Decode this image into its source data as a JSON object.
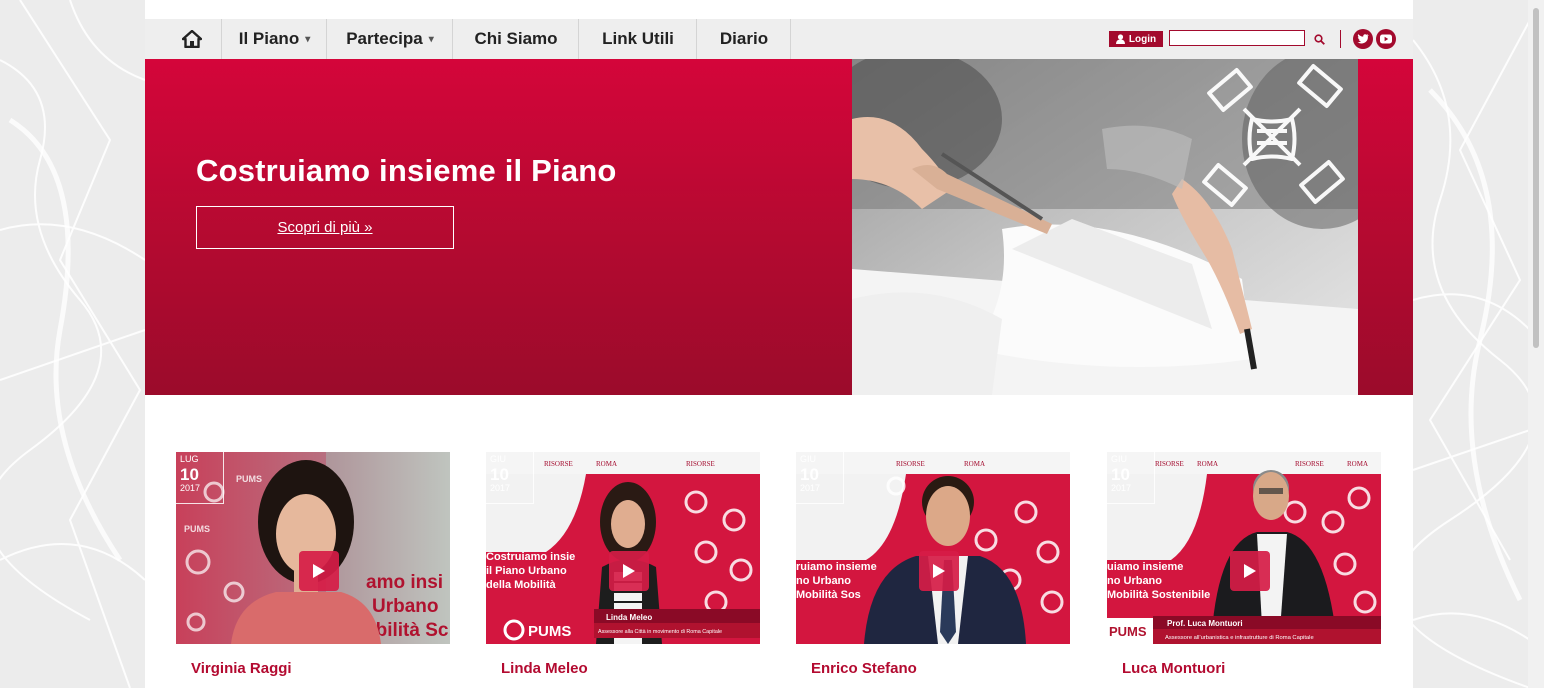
{
  "nav": {
    "items": [
      {
        "label": "Il Piano",
        "caret": "▾"
      },
      {
        "label": "Partecipa",
        "caret": "▾"
      },
      {
        "label": "Chi Siamo",
        "caret": ""
      },
      {
        "label": "Link Utili",
        "caret": ""
      },
      {
        "label": "Diario",
        "caret": ""
      }
    ],
    "login_label": "Login",
    "search": {
      "value": "",
      "placeholder": ""
    },
    "icons": {
      "home": "home-icon",
      "user": "user-icon",
      "search": "search-icon",
      "twitter": "twitter-icon",
      "youtube": "youtube-icon"
    }
  },
  "hero": {
    "title": "Costruiamo insieme il Piano",
    "button_label": "Scopri di più »"
  },
  "videos": [
    {
      "name": "Virginia Raggi",
      "month": "LUG",
      "day": "10",
      "year": "2017",
      "overlay_title": "",
      "overlay_subtitle": "",
      "slide_text": [
        "amo insi",
        "Urbano",
        "obilità Sc"
      ]
    },
    {
      "name": "Linda Meleo",
      "month": "GIU",
      "day": "10",
      "year": "2017",
      "overlay_title": "Linda Meleo",
      "overlay_subtitle": "Assessore alla Città in movimento di Roma Capitale",
      "slide_text": [
        "Costruiamo insie",
        "il Piano Urbano",
        "della Mobilità"
      ]
    },
    {
      "name": "Enrico Stefano",
      "month": "GIU",
      "day": "10",
      "year": "2017",
      "overlay_title": "",
      "overlay_subtitle": "",
      "slide_text": [
        "ruiamo insieme",
        "no Urbano",
        "Mobilità Sos"
      ]
    },
    {
      "name": "Luca Montuori",
      "month": "GIU",
      "day": "10",
      "year": "2017",
      "overlay_title": "Prof. Luca Montuori",
      "overlay_subtitle": "Assessore all'urbanistica e infrastrutture di Roma Capitale",
      "slide_text": [
        "uiamo insieme",
        "no Urbano",
        "Mobilità Sostenibile"
      ]
    }
  ],
  "thumb_labels": {
    "pums": "PUMS",
    "roma": "ROMA",
    "risorse": "RISORSE"
  },
  "colors": {
    "brand": "#a30a2d",
    "hero_top": "#d4053a",
    "hero_bottom": "#9b0b2b",
    "nav_bg": "#eeeeee"
  }
}
